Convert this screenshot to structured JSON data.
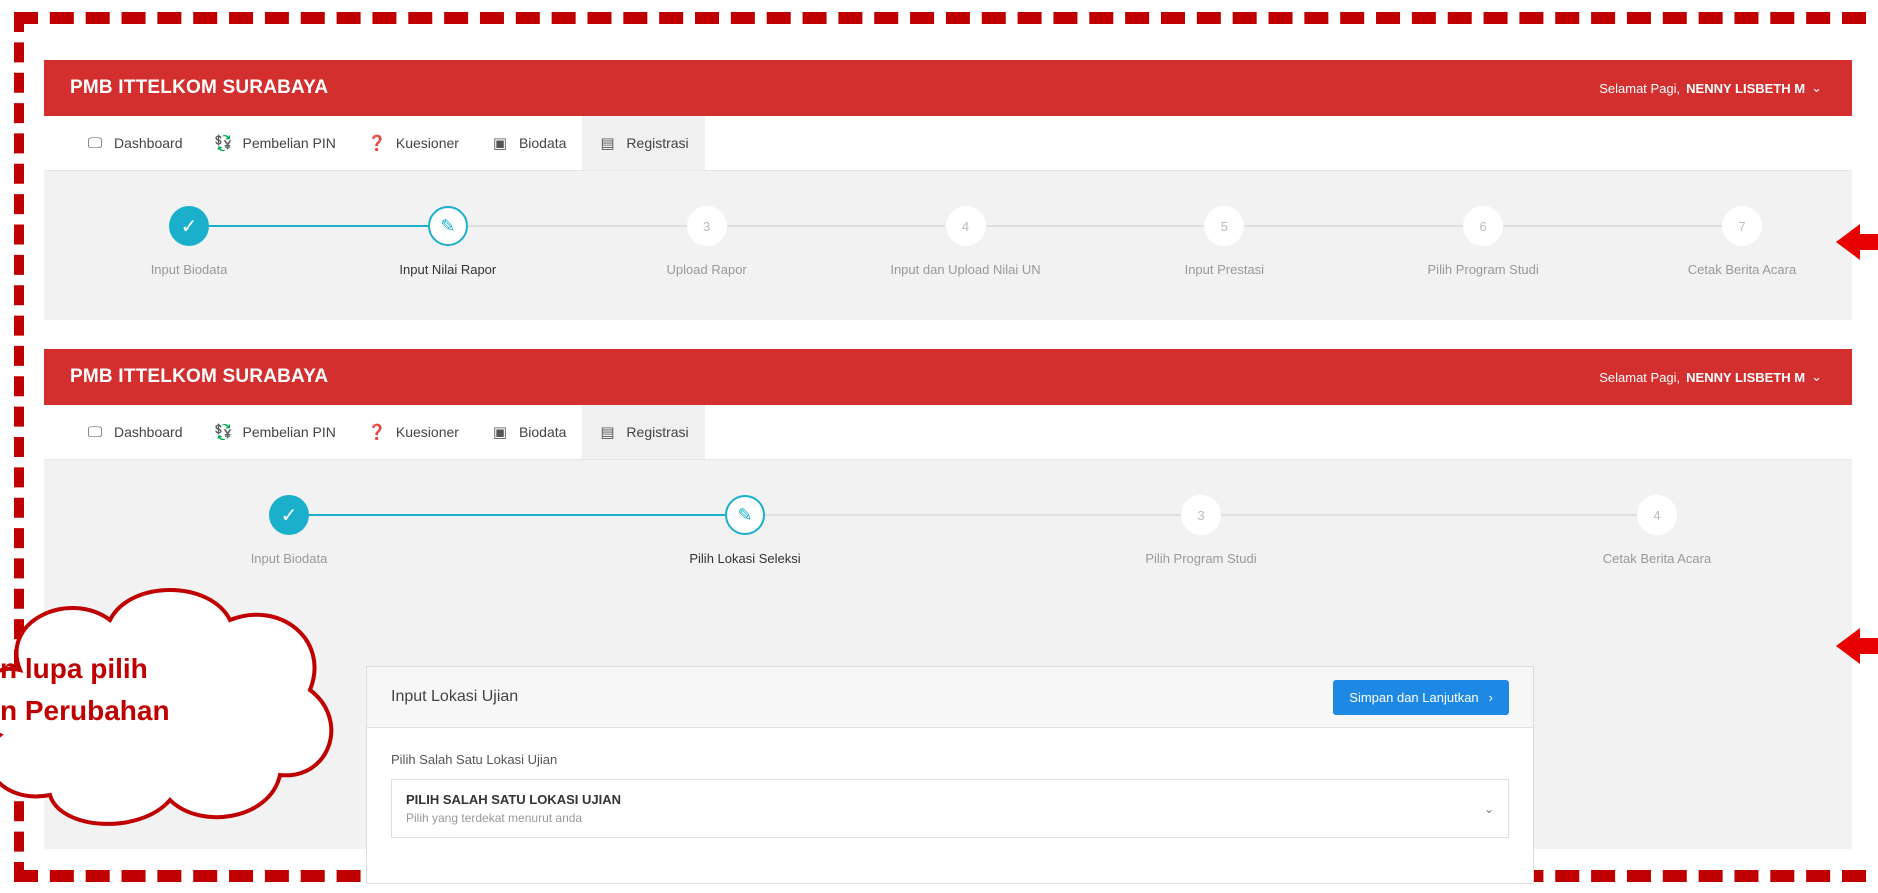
{
  "app": {
    "brand": "PMB ITTELKOM SURABAYA",
    "greeting_prefix": "Selamat Pagi,",
    "user_name": "NENNY LISBETH M"
  },
  "nav": [
    {
      "label": "Dashboard",
      "icon": "monitor-icon"
    },
    {
      "label": "Pembelian PIN",
      "icon": "money-icon"
    },
    {
      "label": "Kuesioner",
      "icon": "help-icon"
    },
    {
      "label": "Biodata",
      "icon": "id-card-icon"
    },
    {
      "label": "Registrasi",
      "icon": "document-icon"
    }
  ],
  "panel1": {
    "steps": [
      {
        "num": "",
        "label": "Input Biodata",
        "state": "done"
      },
      {
        "num": "",
        "label": "Input Nilai Rapor",
        "state": "current"
      },
      {
        "num": "3",
        "label": "Upload Rapor",
        "state": "todo"
      },
      {
        "num": "4",
        "label": "Input dan Upload Nilai UN",
        "state": "todo"
      },
      {
        "num": "5",
        "label": "Input Prestasi",
        "state": "todo"
      },
      {
        "num": "6",
        "label": "Pilih Program Studi",
        "state": "todo"
      },
      {
        "num": "7",
        "label": "Cetak Berita Acara",
        "state": "todo"
      }
    ]
  },
  "panel2": {
    "steps": [
      {
        "num": "",
        "label": "Input Biodata",
        "state": "done"
      },
      {
        "num": "",
        "label": "Pilih Lokasi Seleksi",
        "state": "current"
      },
      {
        "num": "3",
        "label": "Pilih Program Studi",
        "state": "todo"
      },
      {
        "num": "4",
        "label": "Cetak Berita Acara",
        "state": "todo"
      }
    ],
    "card": {
      "title": "Input Lokasi Ujian",
      "button": "Simpan dan Lanjutkan",
      "field_label": "Pilih Salah Satu Lokasi Ujian",
      "select_main": "PILIH SALAH SATU LOKASI UJIAN",
      "select_sub": "Pilih yang terdekat menurut anda"
    }
  },
  "callout": {
    "line1": "n lupa pilih",
    "line2": "n Perubahan"
  },
  "colors": {
    "brand_red": "#d32f2f",
    "step_teal": "#1ab0cc",
    "button_blue": "#1e88e5",
    "annotation_red": "#c00000"
  }
}
